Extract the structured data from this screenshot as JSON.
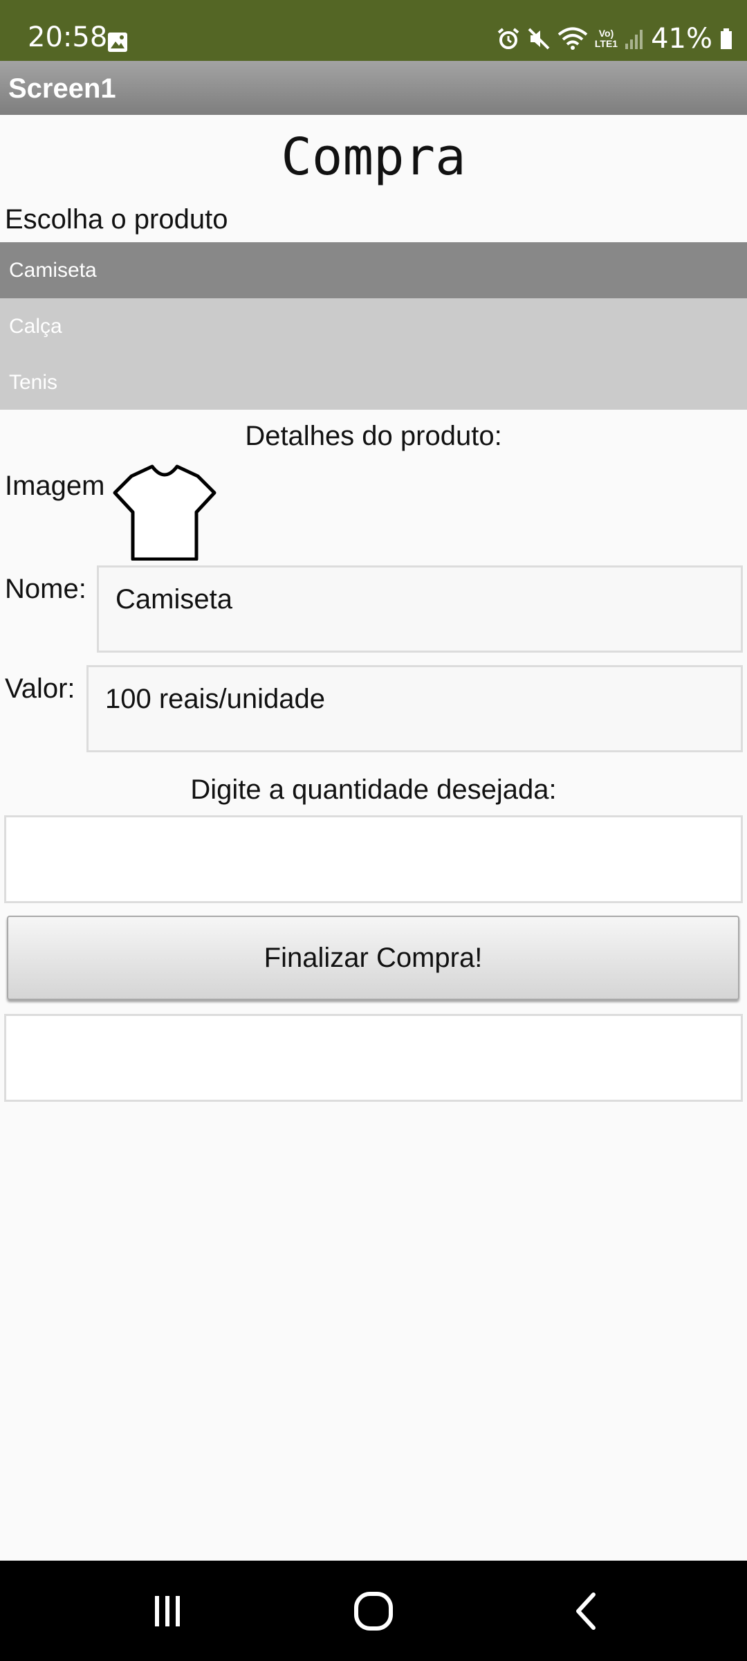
{
  "status": {
    "time": "20:58",
    "battery": "41%",
    "lte_label_top": "Vo)",
    "lte_label_bottom": "LTE1"
  },
  "app_bar": {
    "title": "Screen1"
  },
  "page": {
    "title": "Compra"
  },
  "product_picker": {
    "label": "Escolha o produto",
    "items": [
      "Camiseta",
      "Calça",
      "Tenis"
    ],
    "selected": "Camiseta"
  },
  "details": {
    "heading": "Detalhes do produto:",
    "image_label": "Imagem",
    "image_icon": "t-shirt-icon",
    "name_label": "Nome:",
    "name_value": "Camiseta",
    "value_label": "Valor:",
    "value_value": "100 reais/unidade"
  },
  "quantity": {
    "label": "Digite a quantidade desejada:",
    "value": ""
  },
  "finish_button": {
    "label": "Finalizar Compra!"
  },
  "result": {
    "value": ""
  },
  "colors": {
    "status_bar": "#546625",
    "app_bar": "#8a8a8a",
    "selected_item": "#888888",
    "list_bg": "#cbcbcb"
  },
  "navigation": {
    "icons": [
      "recent-apps-icon",
      "home-icon",
      "back-icon"
    ]
  }
}
